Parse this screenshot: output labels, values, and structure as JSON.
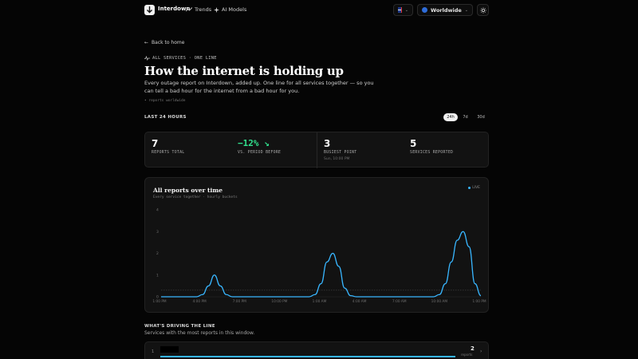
{
  "header": {
    "brand": "Interdown",
    "nav": [
      {
        "label": "Trends",
        "icon": "trend-line-icon"
      },
      {
        "label": "AI Models",
        "icon": "sparkle-icon"
      }
    ],
    "region_label": "Worldwide",
    "language_icon": "uk-flag-icon",
    "theme_icon": "sun-icon"
  },
  "page": {
    "back_link": "Back to home",
    "eyebrow": "ALL SERVICES · ONE LINE",
    "title": "How the internet is holding up",
    "subtitle": "Every outage report on Interdown, added up. One line for all services together — so you can tell a bad hour for the internet from a bad hour for you.",
    "note": "• reports worldwide",
    "window_label": "LAST 24 HOURS",
    "ranges": [
      {
        "label": "24h",
        "active": true
      },
      {
        "label": "7d",
        "active": false
      },
      {
        "label": "30d",
        "active": false
      }
    ]
  },
  "stats": [
    {
      "value": "7",
      "label": "REPORTS TOTAL",
      "sub": ""
    },
    {
      "value": "−12% ↘",
      "label": "VS. PERIOD BEFORE",
      "sub": ""
    },
    {
      "value": "3",
      "label": "BUSIEST POINT",
      "sub": "Sun, 10:00 PM"
    },
    {
      "value": "5",
      "label": "SERVICES REPORTED",
      "sub": ""
    }
  ],
  "chart": {
    "title": "All reports over time",
    "subtitle": "Every service together · hourly buckets",
    "legend": "LIVE"
  },
  "chart_data": {
    "type": "area",
    "title": "All reports over time",
    "x": [
      "1:00 PM",
      "4:00 PM",
      "7:00 PM",
      "10:00 PM",
      "1:00 AM",
      "4:00 AM",
      "7:00 AM",
      "10:00 AM",
      "1:00 PM"
    ],
    "y_ticks": [
      0,
      1,
      2,
      3,
      4
    ],
    "ylim": [
      0,
      4
    ],
    "baseline": 0.3,
    "peaks": [
      {
        "label": "~6:00 PM",
        "value": 1
      },
      {
        "label": "~3:00 AM",
        "value": 2
      },
      {
        "label": "~10:00 PM",
        "value": 3
      }
    ],
    "series": [
      {
        "values": [
          0,
          0,
          0,
          0,
          0,
          0,
          0,
          0.1,
          0.5,
          1,
          0.5,
          0.1,
          0,
          0,
          0,
          0,
          0,
          0,
          0,
          0,
          0,
          0,
          0,
          0,
          0,
          0,
          0.1,
          0.6,
          1.6,
          2,
          1.4,
          0.4,
          0.05,
          0,
          0,
          0,
          0,
          0,
          0,
          0,
          0,
          0,
          0,
          0,
          0,
          0,
          0,
          0.1,
          0.6,
          1.6,
          2.6,
          3,
          2.3,
          0.6,
          0.05
        ]
      }
    ],
    "line_color": "#38b6ff",
    "grid": false
  },
  "driving": {
    "label": "WHAT'S DRIVING THE LINE",
    "subtitle": "Services with the most reports in this window.",
    "rows": [
      {
        "rank": "1",
        "count": "2",
        "count_label": "reports",
        "share": 1.0
      }
    ]
  }
}
